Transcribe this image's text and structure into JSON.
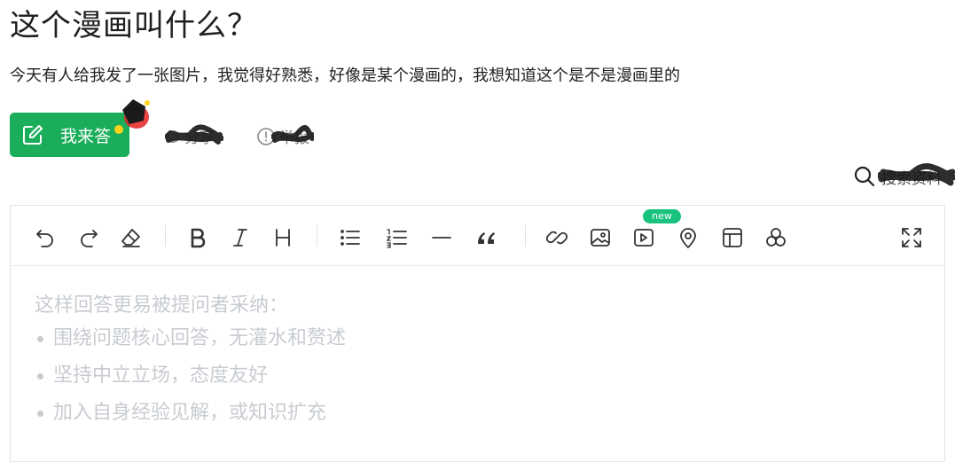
{
  "question": {
    "title": "这个漫画叫什么？",
    "description": "今天有人给我发了一张图片，我觉得好熟悉，好像是某个漫画的，我想知道这个是不是漫画里的"
  },
  "actions": {
    "answer_label": "我来答",
    "share_label": "分享",
    "report_label": "举报"
  },
  "search": {
    "label": "搜索资料"
  },
  "editor": {
    "new_badge": "new",
    "tools": [
      "undo-icon",
      "redo-icon",
      "eraser-icon",
      "bold-icon",
      "italic-icon",
      "heading-icon",
      "bullet-list-icon",
      "numbered-list-icon",
      "divider-icon",
      "quote-icon",
      "link-icon",
      "image-icon",
      "video-icon",
      "location-icon",
      "table-icon",
      "more-icon",
      "fullscreen-icon"
    ],
    "hint_title": "这样回答更易被提问者采纳：",
    "hint_items": [
      "围绕问题核心回答，无灌水和赘述",
      "坚持中立立场，态度友好",
      "加入自身经验见解，或知识扩充"
    ]
  },
  "colors": {
    "accent": "#1aad5a",
    "badge": "#19c37d",
    "placeholder": "#c8ccd1"
  }
}
